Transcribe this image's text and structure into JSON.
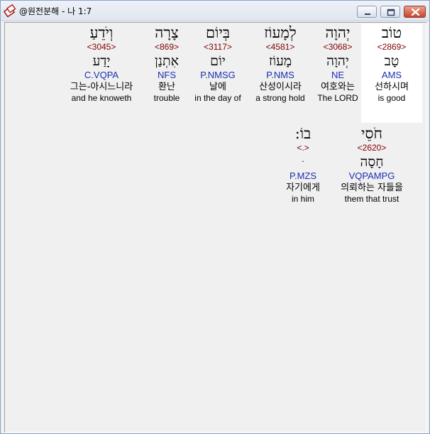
{
  "window": {
    "title": "@원전분해 - 나 1:7"
  },
  "words": [
    {
      "hebrew": "טוֹב",
      "strong": "<2869>",
      "lemma": "טָב",
      "morph": "AMS",
      "korean": "선하시며",
      "english": "is good"
    },
    {
      "hebrew": "יְהוָה",
      "strong": "<3068>",
      "lemma": "יְהוָה",
      "morph": "NE",
      "korean": "여호와는",
      "english": "The LORD"
    },
    {
      "hebrew": "לְמָעוֹז",
      "strong": "<4581>",
      "lemma": "מָעוֹז",
      "morph": "P.NMS",
      "korean": "산성이시라",
      "english": "a strong hold"
    },
    {
      "hebrew": "בְּיוֹם",
      "strong": "<3117>",
      "lemma": "יוֹם",
      "morph": "P.NMSG",
      "korean": "날에",
      "english": "in the day of"
    },
    {
      "hebrew": "צָרָה",
      "strong": "<869>",
      "lemma": "אִתְנַן",
      "morph": "NFS",
      "korean": "환난",
      "english": "trouble"
    },
    {
      "hebrew": "וְיֹדֵעַ",
      "strong": "<3045>",
      "lemma": "יָדַע",
      "morph": "C.VQPA",
      "korean": "그는-아시느니라",
      "english": "and he knoweth"
    },
    {
      "hebrew": "חֹסֵי",
      "strong": "<2620>",
      "lemma": "חָסָה",
      "morph": "VQPAMPG",
      "korean": "의뢰하는 자들을",
      "english": "them that trust"
    },
    {
      "hebrew": "בוֹ:",
      "strong": "<.>",
      "lemma": "ּ",
      "morph": "P.MZS",
      "korean": "자기에게",
      "english": "in him"
    }
  ]
}
